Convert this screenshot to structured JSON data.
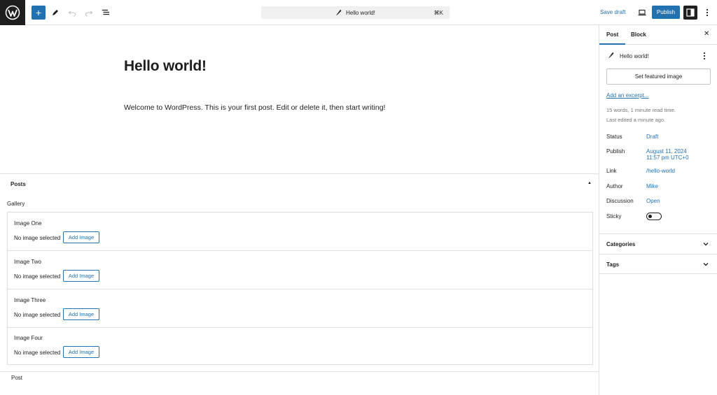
{
  "toolbar": {
    "add_symbol": "+",
    "command_bar_title": "Hello world!",
    "command_bar_shortcut": "⌘K",
    "save_draft_label": "Save draft",
    "publish_label": "Publish"
  },
  "post": {
    "title": "Hello world!",
    "body": "Welcome to WordPress. This is your first post. Edit or delete it, then start writing!"
  },
  "metabox": {
    "title": "Posts",
    "toggle_symbol": "▲",
    "gallery_label": "Gallery",
    "items": [
      {
        "label": "Image One",
        "status": "No image selected",
        "button": "Add Image"
      },
      {
        "label": "Image Two",
        "status": "No image selected",
        "button": "Add Image"
      },
      {
        "label": "Image Three",
        "status": "No image selected",
        "button": "Add Image"
      },
      {
        "label": "Image Four",
        "status": "No image selected",
        "button": "Add Image"
      }
    ]
  },
  "footer": {
    "breadcrumb": "Post"
  },
  "sidebar": {
    "tabs": [
      "Post",
      "Block"
    ],
    "close_symbol": "✕",
    "post_title": "Hello world!",
    "featured_image_label": "Set featured image",
    "excerpt_link": "Add an excerpt...",
    "word_count": "15 words, 1 minute read time.",
    "last_edited": "Last edited a minute ago.",
    "meta": {
      "status": {
        "label": "Status",
        "value": "Draft"
      },
      "publish": {
        "label": "Publish",
        "value_line1": "August 11, 2024",
        "value_line2": "11:57 pm UTC+0"
      },
      "link": {
        "label": "Link",
        "value": "/hello-world"
      },
      "author": {
        "label": "Author",
        "value": "Mike"
      },
      "discussion": {
        "label": "Discussion",
        "value": "Open"
      },
      "sticky": {
        "label": "Sticky"
      }
    },
    "panels": [
      "Categories",
      "Tags"
    ]
  },
  "colors": {
    "accent": "#2271b1",
    "dark": "#1e1e1e",
    "border": "#e0e0e0"
  },
  "icons": [
    "wordpress-logo-icon",
    "plus-icon",
    "pen-tool-icon",
    "undo-icon",
    "redo-icon",
    "document-overview-icon",
    "feather-icon",
    "desktop-preview-icon",
    "settings-sidebar-icon",
    "more-options-icon",
    "close-icon",
    "chevron-down-icon",
    "chevron-up-icon"
  ]
}
